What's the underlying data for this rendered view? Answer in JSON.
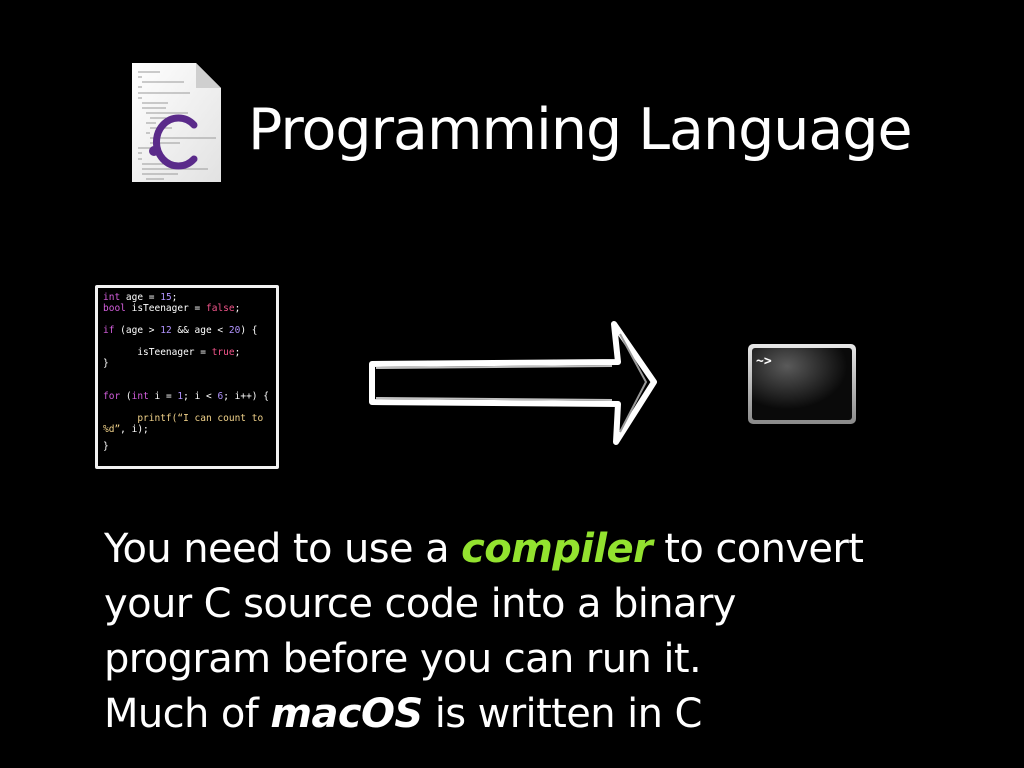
{
  "title": "Programming Language",
  "file_icon": {
    "icon": "c-source-file-icon",
    "letter": "C",
    "letter_color": "#5a2a8a"
  },
  "code": {
    "l1": {
      "kw": "int",
      "rest": " age = ",
      "num": "15",
      "end": ";"
    },
    "l2": {
      "kw": "bool",
      "rest": " isTeenager = ",
      "val": "false",
      "end": ";"
    },
    "l3": {
      "kw": "if",
      "a": " (age > ",
      "n1": "12",
      "b": " && age < ",
      "n2": "20",
      "c": ") {"
    },
    "l4": {
      "indent": "      ",
      "rest": "isTeenager = ",
      "val": "true",
      "end": ";"
    },
    "l5": "}",
    "l6": {
      "kw": "for",
      "a": " (",
      "kw2": "int",
      "b": " i = ",
      "n1": "1",
      "c": "; i < ",
      "n2": "6",
      "d": "; i++) {"
    },
    "l7": {
      "indent": "      ",
      "fn": "printf",
      "str": "(“I can count to"
    },
    "l8": {
      "str": "%d”",
      "rest": ", i);"
    },
    "l9": "}"
  },
  "terminal": {
    "icon": "terminal-icon",
    "prompt": "~>"
  },
  "arrow": {
    "icon": "right-arrow-icon"
  },
  "body": {
    "line1_pre": "You need to use a ",
    "line1_em": "compiler",
    "line1_post": " to convert",
    "line2": "your C source code into a binary",
    "line3": "program before you can run it.",
    "line4_pre": "Much of ",
    "line4_em": "macOS",
    "line4_post": " is written in C"
  },
  "colors": {
    "background": "#000000",
    "text": "#ffffff",
    "compiler_highlight": "#93e22f"
  }
}
